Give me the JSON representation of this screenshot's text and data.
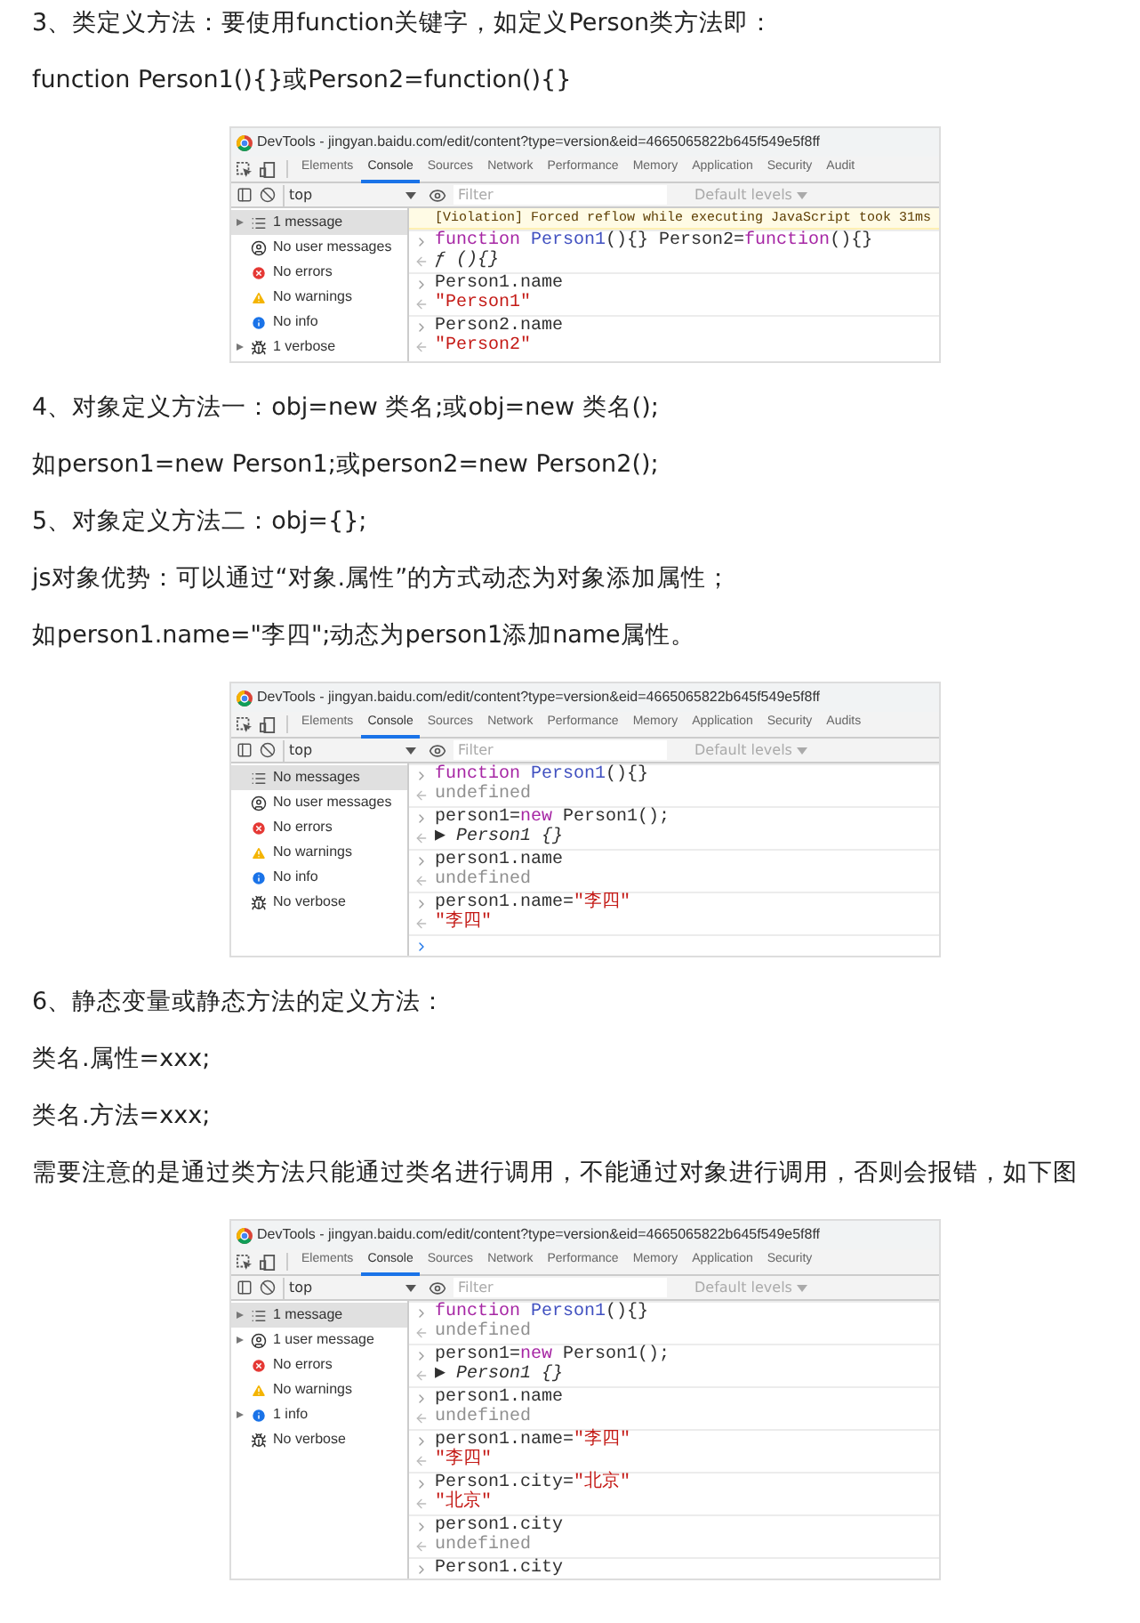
{
  "content": [
    {
      "kind": "text",
      "text": "3、类定义方法：要使用function关键字，如定义Person类方法即："
    },
    {
      "kind": "text",
      "text": "function Person1(){}或Person2=function(){}"
    },
    {
      "kind": "devtools",
      "title": "DevTools - jingyan.baidu.com/edit/content?type=version&eid=4665065822b645f549e5f8ff",
      "tabs": [
        {
          "label": "Elements",
          "selected": false
        },
        {
          "label": "Console",
          "selected": true
        },
        {
          "label": "Sources",
          "selected": false
        },
        {
          "label": "Network",
          "selected": false
        },
        {
          "label": "Performance",
          "selected": false
        },
        {
          "label": "Memory",
          "selected": false
        },
        {
          "label": "Application",
          "selected": false
        },
        {
          "label": "Security",
          "selected": false
        },
        {
          "label": "Audit",
          "selected": false
        }
      ],
      "context": "top",
      "filter_placeholder": "Filter",
      "levels": "Default levels",
      "sidebar": [
        {
          "kind": "list",
          "label": "1 message",
          "expandable": true,
          "selected": true
        },
        {
          "kind": "user",
          "label": "No user messages",
          "expandable": false,
          "selected": false
        },
        {
          "kind": "error",
          "label": "No errors",
          "expandable": false,
          "selected": false
        },
        {
          "kind": "warning",
          "label": "No warnings",
          "expandable": false,
          "selected": false
        },
        {
          "kind": "info",
          "label": "No info",
          "expandable": false,
          "selected": false
        },
        {
          "kind": "verbose",
          "label": "1 verbose",
          "expandable": true,
          "selected": false
        }
      ],
      "console": [
        {
          "kind": "warning",
          "segments": [
            {
              "kind": "warn",
              "text": "[Violation] Forced reflow while executing JavaScript took 31ms"
            }
          ]
        },
        {
          "kind": "input",
          "segments": [
            {
              "kind": "keyword",
              "text": "function "
            },
            {
              "kind": "name",
              "text": "Person1"
            },
            {
              "kind": "plain",
              "text": "(){} Person2="
            },
            {
              "kind": "keyword",
              "text": "function"
            },
            {
              "kind": "plain",
              "text": "(){}"
            }
          ]
        },
        {
          "kind": "output",
          "segments": [
            {
              "kind": "object",
              "text": "ƒ (){}"
            }
          ]
        },
        {
          "kind": "input",
          "segments": [
            {
              "kind": "plain",
              "text": "Person1.name"
            }
          ]
        },
        {
          "kind": "output",
          "segments": [
            {
              "kind": "string",
              "text": "\"Person1\""
            }
          ]
        },
        {
          "kind": "input",
          "segments": [
            {
              "kind": "plain",
              "text": "Person2.name"
            }
          ]
        },
        {
          "kind": "output",
          "segments": [
            {
              "kind": "string",
              "text": "\"Person2\""
            }
          ]
        }
      ]
    },
    {
      "kind": "text",
      "text": "4、对象定义方法一：obj=new 类名;或obj=new 类名();"
    },
    {
      "kind": "text",
      "text": "如person1=new Person1;或person2=new Person2();"
    },
    {
      "kind": "text",
      "text": "5、对象定义方法二：obj={};"
    },
    {
      "kind": "text",
      "text": "js对象优势：可以通过“对象.属性”的方式动态为对象添加属性；"
    },
    {
      "kind": "text",
      "text": "如person1.name=\"李四\";动态为person1添加name属性。"
    },
    {
      "kind": "devtools",
      "title": "DevTools - jingyan.baidu.com/edit/content?type=version&eid=4665065822b645f549e5f8ff",
      "tabs": [
        {
          "label": "Elements",
          "selected": false
        },
        {
          "label": "Console",
          "selected": true
        },
        {
          "label": "Sources",
          "selected": false
        },
        {
          "label": "Network",
          "selected": false
        },
        {
          "label": "Performance",
          "selected": false
        },
        {
          "label": "Memory",
          "selected": false
        },
        {
          "label": "Application",
          "selected": false
        },
        {
          "label": "Security",
          "selected": false
        },
        {
          "label": "Audits",
          "selected": false
        }
      ],
      "context": "top",
      "filter_placeholder": "Filter",
      "levels": "Default levels",
      "sidebar": [
        {
          "kind": "list",
          "label": "No messages",
          "expandable": false,
          "selected": true
        },
        {
          "kind": "user",
          "label": "No user messages",
          "expandable": false,
          "selected": false
        },
        {
          "kind": "error",
          "label": "No errors",
          "expandable": false,
          "selected": false
        },
        {
          "kind": "warning",
          "label": "No warnings",
          "expandable": false,
          "selected": false
        },
        {
          "kind": "info",
          "label": "No info",
          "expandable": false,
          "selected": false
        },
        {
          "kind": "verbose",
          "label": "No verbose",
          "expandable": false,
          "selected": false
        }
      ],
      "console": [
        {
          "kind": "input",
          "segments": [
            {
              "kind": "keyword",
              "text": "function "
            },
            {
              "kind": "name",
              "text": "Person1"
            },
            {
              "kind": "plain",
              "text": "(){}"
            }
          ]
        },
        {
          "kind": "output",
          "segments": [
            {
              "kind": "dim",
              "text": "undefined"
            }
          ]
        },
        {
          "kind": "input",
          "segments": [
            {
              "kind": "plain",
              "text": "person1="
            },
            {
              "kind": "keyword",
              "text": "new"
            },
            {
              "kind": "plain",
              "text": " Person1();"
            }
          ]
        },
        {
          "kind": "output",
          "segments": [
            {
              "kind": "object",
              "text": "▶ Person1 {}"
            }
          ]
        },
        {
          "kind": "input",
          "segments": [
            {
              "kind": "plain",
              "text": "person1.name"
            }
          ]
        },
        {
          "kind": "output",
          "segments": [
            {
              "kind": "dim",
              "text": "undefined"
            }
          ]
        },
        {
          "kind": "input",
          "segments": [
            {
              "kind": "plain",
              "text": "person1.name="
            },
            {
              "kind": "string",
              "text": "\"李四\""
            }
          ]
        },
        {
          "kind": "output",
          "segments": [
            {
              "kind": "string",
              "text": "\"李四\""
            }
          ]
        },
        {
          "kind": "prompt"
        }
      ]
    },
    {
      "kind": "text",
      "text": "6、静态变量或静态方法的定义方法："
    },
    {
      "kind": "text",
      "text": "类名.属性=xxx;"
    },
    {
      "kind": "text",
      "text": "类名.方法=xxx;"
    },
    {
      "kind": "text",
      "text": "需要注意的是通过类方法只能通过类名进行调用，不能通过对象进行调用，否则会报错，如下图"
    },
    {
      "kind": "devtools",
      "title": "DevTools - jingyan.baidu.com/edit/content?type=version&eid=4665065822b645f549e5f8ff",
      "tabs": [
        {
          "label": "Elements",
          "selected": false
        },
        {
          "label": "Console",
          "selected": true
        },
        {
          "label": "Sources",
          "selected": false
        },
        {
          "label": "Network",
          "selected": false
        },
        {
          "label": "Performance",
          "selected": false
        },
        {
          "label": "Memory",
          "selected": false
        },
        {
          "label": "Application",
          "selected": false
        },
        {
          "label": "Security",
          "selected": false
        }
      ],
      "context": "top",
      "filter_placeholder": "Filter",
      "levels": "Default levels",
      "sidebar": [
        {
          "kind": "list",
          "label": "1 message",
          "expandable": true,
          "selected": true
        },
        {
          "kind": "user",
          "label": "1 user message",
          "expandable": true,
          "selected": false
        },
        {
          "kind": "error",
          "label": "No errors",
          "expandable": false,
          "selected": false
        },
        {
          "kind": "warning",
          "label": "No warnings",
          "expandable": false,
          "selected": false
        },
        {
          "kind": "info",
          "label": "1 info",
          "expandable": true,
          "selected": false
        },
        {
          "kind": "verbose",
          "label": "No verbose",
          "expandable": false,
          "selected": false
        }
      ],
      "console": [
        {
          "kind": "input",
          "segments": [
            {
              "kind": "keyword",
              "text": "function "
            },
            {
              "kind": "name",
              "text": "Person1"
            },
            {
              "kind": "plain",
              "text": "(){}"
            }
          ]
        },
        {
          "kind": "output",
          "segments": [
            {
              "kind": "dim",
              "text": "undefined"
            }
          ]
        },
        {
          "kind": "input",
          "segments": [
            {
              "kind": "plain",
              "text": "person1="
            },
            {
              "kind": "keyword",
              "text": "new"
            },
            {
              "kind": "plain",
              "text": " Person1();"
            }
          ]
        },
        {
          "kind": "output",
          "segments": [
            {
              "kind": "object",
              "text": "▶ Person1 {}"
            }
          ]
        },
        {
          "kind": "input",
          "segments": [
            {
              "kind": "plain",
              "text": "person1.name"
            }
          ]
        },
        {
          "kind": "output",
          "segments": [
            {
              "kind": "dim",
              "text": "undefined"
            }
          ]
        },
        {
          "kind": "input",
          "segments": [
            {
              "kind": "plain",
              "text": "person1.name="
            },
            {
              "kind": "string",
              "text": "\"李四\""
            }
          ]
        },
        {
          "kind": "output",
          "segments": [
            {
              "kind": "string",
              "text": "\"李四\""
            }
          ]
        },
        {
          "kind": "input",
          "segments": [
            {
              "kind": "plain",
              "text": "Person1.city="
            },
            {
              "kind": "string",
              "text": "\"北京\""
            }
          ]
        },
        {
          "kind": "output",
          "segments": [
            {
              "kind": "string",
              "text": "\"北京\""
            }
          ]
        },
        {
          "kind": "input",
          "segments": [
            {
              "kind": "plain",
              "text": "person1.city"
            }
          ]
        },
        {
          "kind": "output",
          "segments": [
            {
              "kind": "dim",
              "text": "undefined"
            }
          ]
        },
        {
          "kind": "input",
          "segments": [
            {
              "kind": "plain",
              "text": "Person1.city"
            }
          ]
        }
      ]
    }
  ]
}
